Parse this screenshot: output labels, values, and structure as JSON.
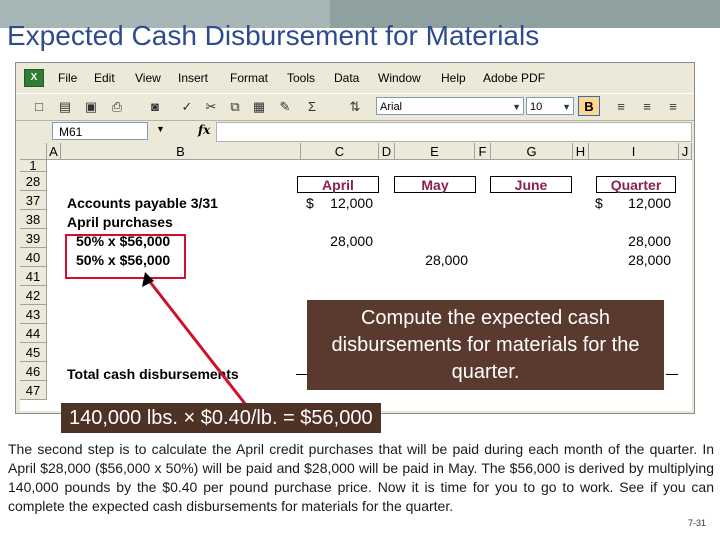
{
  "slide": {
    "title": "Expected Cash Disbursement for Materials",
    "page_number": "7-31"
  },
  "excel": {
    "menu": [
      "File",
      "Edit",
      "View",
      "Insert",
      "Format",
      "Tools",
      "Data",
      "Window",
      "Help",
      "Adobe PDF"
    ],
    "font_name": "Arial",
    "font_size": "10",
    "bold_label": "B",
    "name_box": "M61",
    "fx_label": "fx",
    "autosum_label": "Σ",
    "columns": [
      "A",
      "B",
      "C",
      "D",
      "E",
      "F",
      "G",
      "H",
      "I",
      "J"
    ],
    "rows": [
      "1",
      "28",
      "37",
      "38",
      "39",
      "40",
      "41",
      "42",
      "43",
      "44",
      "45",
      "46",
      "47"
    ],
    "months": {
      "april": "April",
      "may": "May",
      "june": "June",
      "quarter": "Quarter"
    },
    "labels": {
      "accounts_payable": "Accounts payable 3/31",
      "april_purchases": "April purchases",
      "line1": "50% x $56,000",
      "line2": "50% x $56,000",
      "total": "Total cash disbursements"
    },
    "values": {
      "ap_dollar": "$",
      "ap_april": "12,000",
      "ap_q_dollar": "$",
      "ap_quarter": "12,000",
      "l1_april": "28,000",
      "l1_quarter": "28,000",
      "l2_may": "28,000",
      "l2_quarter": "28,000"
    }
  },
  "callout": "Compute the expected cash disbursements for materials for the quarter.",
  "calc": "140,000 lbs. × $0.40/lb. = $56,000",
  "paragraph": "The second step is to calculate the April credit purchases that will be paid during each month of the quarter. In April $28,000 ($56,000 x 50%) will be paid and $28,000 will be paid in May. The $56,000 is derived by multiplying 140,000 pounds by the $0.40 per pound purchase price. Now it is time for you to go to work. See if you can complete the expected cash disbursements for materials for the quarter.",
  "colors": {
    "title": "#2f4b8f",
    "month_header": "#8a2252",
    "highlight_border": "#d0102a",
    "callout_bg": "#5a3a2e"
  }
}
